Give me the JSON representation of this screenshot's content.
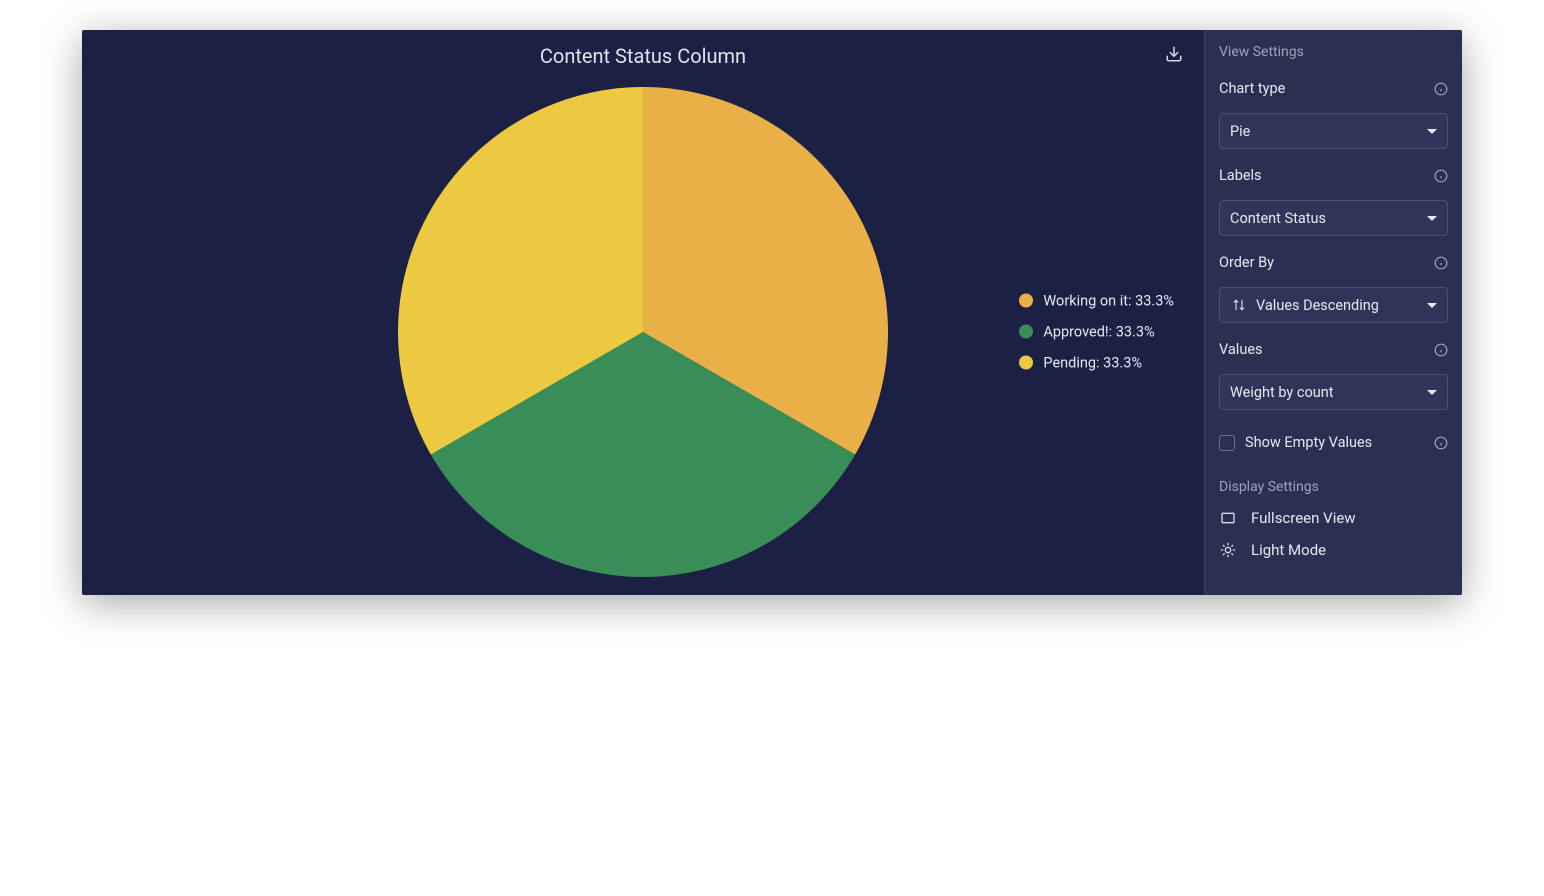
{
  "chart": {
    "title": "Content Status Column"
  },
  "legend": {
    "items": [
      {
        "label": "Working on it: 33.3%",
        "color": "#eab048"
      },
      {
        "label": "Approved!: 33.3%",
        "color": "#388e56"
      },
      {
        "label": "Pending: 33.3%",
        "color": "#ecc940"
      }
    ]
  },
  "sidebar": {
    "view_settings_title": "View Settings",
    "fields": {
      "chart_type": {
        "label": "Chart type",
        "value": "Pie"
      },
      "labels": {
        "label": "Labels",
        "value": "Content Status"
      },
      "order_by": {
        "label": "Order By",
        "value": "Values Descending"
      },
      "values": {
        "label": "Values",
        "value": "Weight by count"
      }
    },
    "show_empty": {
      "label": "Show Empty Values",
      "checked": false
    },
    "display_settings_title": "Display Settings",
    "display_items": {
      "fullscreen": "Fullscreen View",
      "light_mode": "Light Mode"
    }
  },
  "chart_data": {
    "type": "pie",
    "title": "Content Status Column",
    "series": [
      {
        "name": "Working on it",
        "value": 33.3,
        "color": "#eab048"
      },
      {
        "name": "Approved!",
        "value": 33.3,
        "color": "#388e56"
      },
      {
        "name": "Pending",
        "value": 33.3,
        "color": "#ecc940"
      }
    ]
  }
}
